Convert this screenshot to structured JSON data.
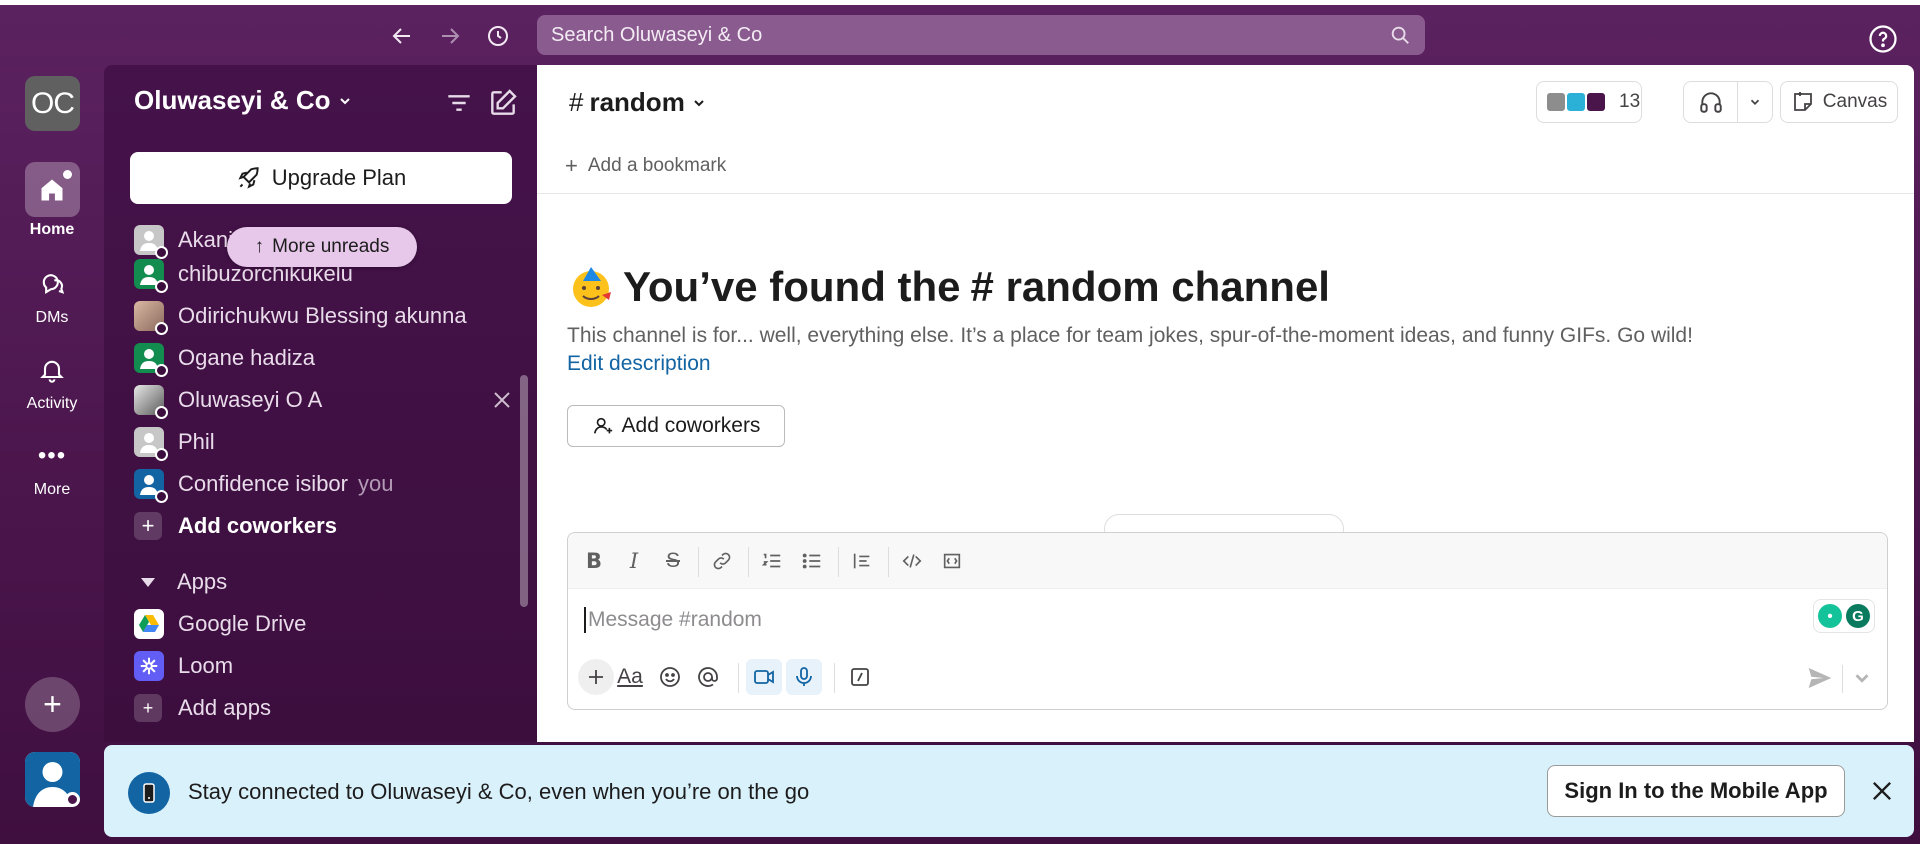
{
  "topbar": {
    "search_placeholder": "Search Oluwaseyi & Co"
  },
  "rail": {
    "workspace_initials": "OC",
    "items": [
      {
        "label": "Home"
      },
      {
        "label": "DMs"
      },
      {
        "label": "Activity"
      },
      {
        "label": "More"
      }
    ]
  },
  "sidebar": {
    "workspace_name": "Oluwaseyi & Co",
    "upgrade_label": "Upgrade Plan",
    "more_unreads": "More unreads",
    "dms": [
      {
        "name": "Akani"
      },
      {
        "name": "chibuzorchikukelu"
      },
      {
        "name": "Odirichukwu Blessing akunna"
      },
      {
        "name": "Ogane hadiza"
      },
      {
        "name": "Oluwaseyi O A"
      },
      {
        "name": "Phil"
      },
      {
        "name": "Confidence isibor",
        "tag": "you"
      }
    ],
    "add_coworkers": "Add coworkers",
    "apps_section": "Apps",
    "apps": [
      {
        "name": "Google Drive"
      },
      {
        "name": "Loom"
      }
    ],
    "add_apps": "Add apps"
  },
  "channel": {
    "hash": "#",
    "name": "random",
    "member_count": "13",
    "canvas_label": "Canvas",
    "add_bookmark": "Add a bookmark",
    "welcome_prefix": "You’ve found the",
    "welcome_channel": "# random channel",
    "description": "This channel is for... well, everything else. It’s a place for team jokes, spur-of-the-moment ideas, and funny GIFs. Go wild!",
    "edit_description": "Edit description",
    "add_coworkers_btn": "Add coworkers"
  },
  "composer": {
    "placeholder": "Message #random",
    "text_format_label": "Aa"
  },
  "banner": {
    "text": "Stay connected to Oluwaseyi & Co, even when you’re on the go",
    "button": "Sign In to the Mobile App"
  },
  "colors": {
    "aubergine": "#4a154b",
    "sidebar": "#3c0e3e",
    "link": "#1264a3",
    "banner_bg": "#d9f1fb"
  }
}
